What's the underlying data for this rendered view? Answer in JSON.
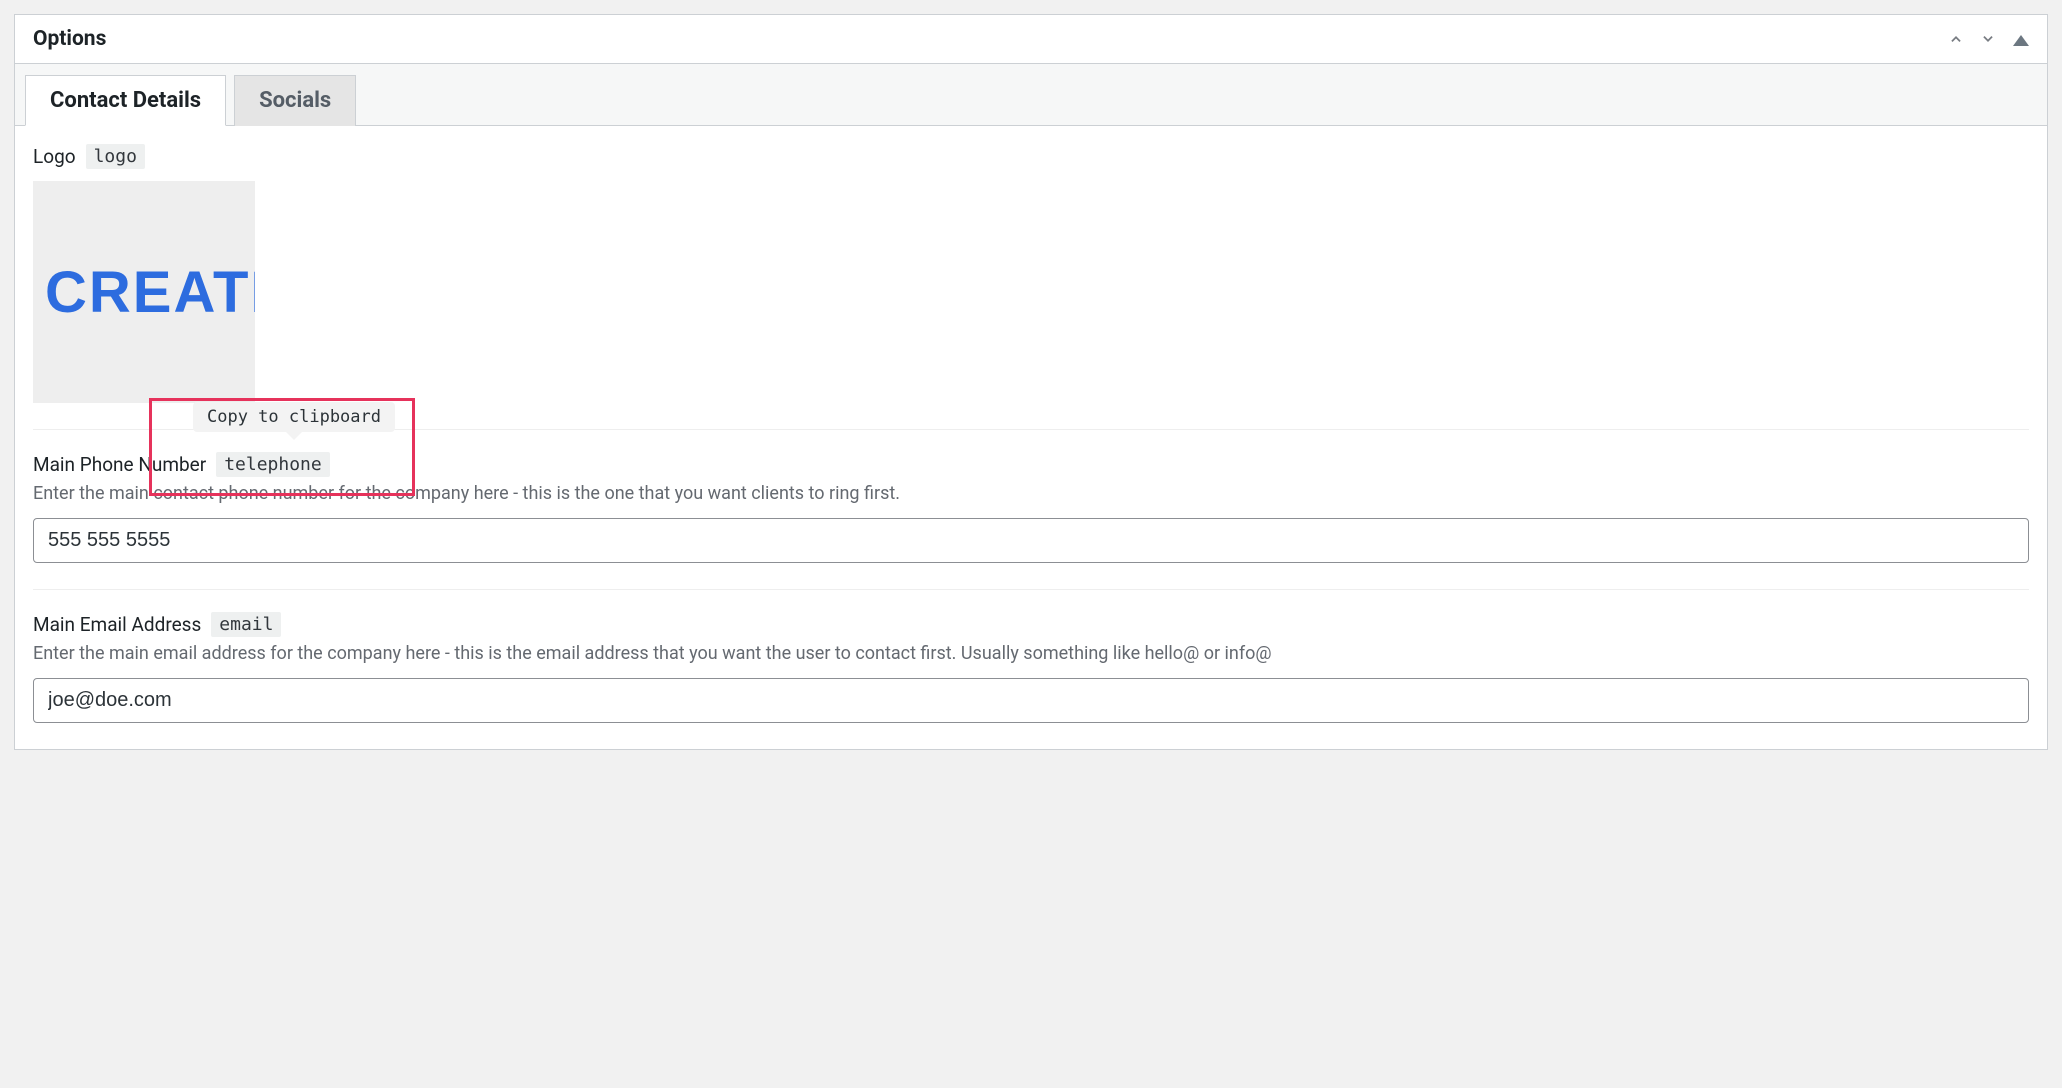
{
  "panel": {
    "title": "Options"
  },
  "tabs": {
    "contact": "Contact Details",
    "socials": "Socials"
  },
  "fields": {
    "logo": {
      "label": "Logo",
      "slug": "logo",
      "preview_text": "CREATIV"
    },
    "phone": {
      "label": "Main Phone Number",
      "slug": "telephone",
      "help": "Enter the main contact phone number for the company here - this is the one that you want clients to ring first.",
      "value": "555 555 5555"
    },
    "email": {
      "label": "Main Email Address",
      "slug": "email",
      "help": "Enter the main email address for the company here - this is the email address that you want the user to contact first. Usually something like hello@ or info@",
      "value": "joe@doe.com"
    }
  },
  "tooltip": {
    "copy": "Copy to clipboard"
  }
}
